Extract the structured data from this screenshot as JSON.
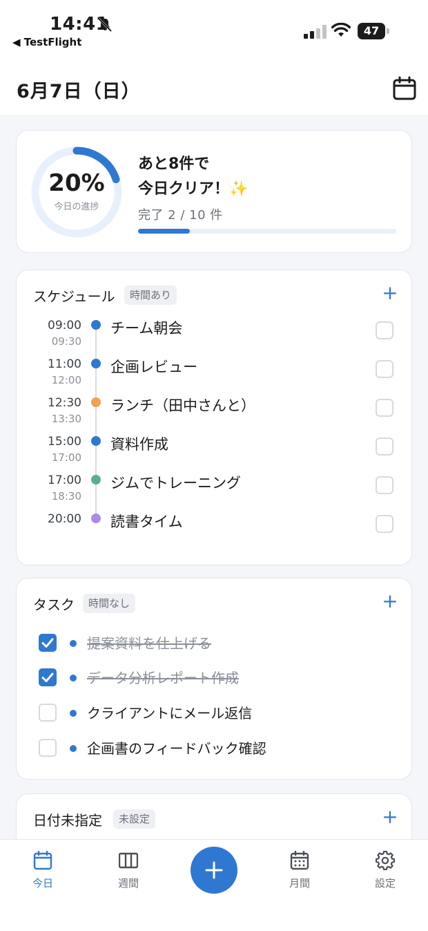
{
  "status_bar": {
    "time": "14:41",
    "back_label": "◀ TestFlight",
    "battery": "47"
  },
  "header": {
    "title": "6月7日（日）",
    "calendar_icon": "calendar-icon"
  },
  "progress": {
    "percent_label": "20%",
    "percent_value": 0.2,
    "ring_caption": "今日の進捗",
    "message_line1": "あと8件で",
    "message_line2": "今日クリア！",
    "sparkle": "✨",
    "done_label": "完了 2 / 10 件",
    "colors": {
      "accent": "#2f78d1",
      "track": "#e8f0fb"
    }
  },
  "schedule": {
    "title": "スケジュール",
    "badge": "時間あり",
    "add_label": "+",
    "events": [
      {
        "start": "09:00",
        "end": "09:30",
        "name": "チーム朝会",
        "color": "#2f78d1",
        "checked": false
      },
      {
        "start": "11:00",
        "end": "12:00",
        "name": "企画レビュー",
        "color": "#2f78d1",
        "checked": false
      },
      {
        "start": "12:30",
        "end": "13:30",
        "name": "ランチ（田中さんと）",
        "color": "#f0a050",
        "checked": false
      },
      {
        "start": "15:00",
        "end": "17:00",
        "name": "資料作成",
        "color": "#2f78d1",
        "checked": false
      },
      {
        "start": "17:00",
        "end": "18:30",
        "name": "ジムでトレーニング",
        "color": "#5ab08a",
        "checked": false
      },
      {
        "start": "20:00",
        "end": "",
        "name": "読書タイム",
        "color": "#a98bea",
        "checked": false
      }
    ]
  },
  "tasks": {
    "title": "タスク",
    "badge": "時間なし",
    "add_label": "+",
    "items": [
      {
        "name": "提案資料を仕上げる",
        "done": true
      },
      {
        "name": "データ分析レポート作成",
        "done": true
      },
      {
        "name": "クライアントにメール返信",
        "done": false
      },
      {
        "name": "企画書のフィードバック確認",
        "done": false
      }
    ]
  },
  "unscheduled": {
    "title": "日付未指定",
    "badge": "未設定",
    "add_label": "+"
  },
  "tabbar": {
    "today": "今日",
    "week": "週間",
    "month": "月間",
    "settings": "設定"
  }
}
